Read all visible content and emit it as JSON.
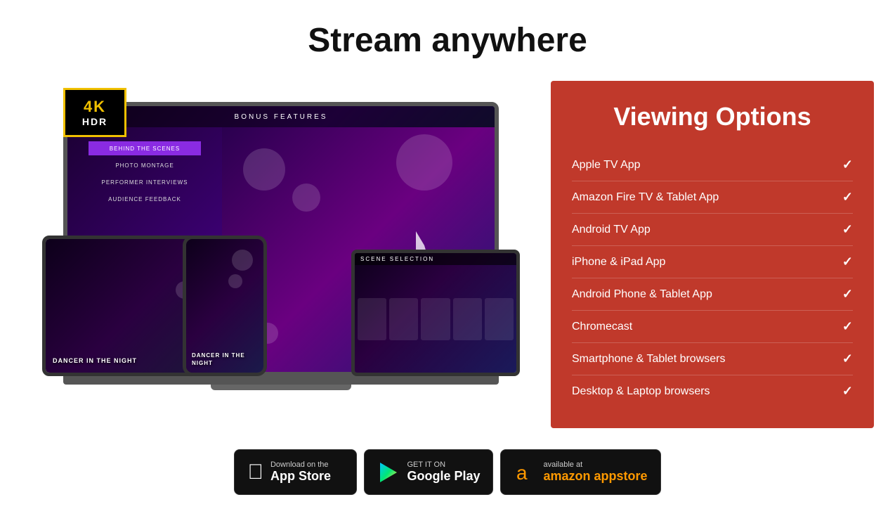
{
  "page": {
    "title": "Stream anywhere"
  },
  "badge4k": {
    "line1": "4K",
    "line2": "HDR"
  },
  "laptopScreen": {
    "nav": "BONUS FEATURES",
    "menuItems": [
      {
        "label": "BEHIND THE SCENES",
        "active": true
      },
      {
        "label": "PHOTO MONTAGE",
        "active": false
      },
      {
        "label": "PERFORMER INTERVIEWS",
        "active": false
      },
      {
        "label": "AUDIENCE FEEDBACK",
        "active": false
      }
    ]
  },
  "tabletTitle": "DANCER IN\nTHE NIGHT",
  "phoneTitle": "DANCER IN\nTHE NIGHT",
  "iPadHeader": "SCENE SELECTION",
  "viewingOptions": {
    "title": "Viewing Options",
    "items": [
      {
        "label": "Apple TV App",
        "checked": true
      },
      {
        "label": "Amazon Fire TV & Tablet App",
        "checked": true
      },
      {
        "label": "Android TV App",
        "checked": true
      },
      {
        "label": "iPhone & iPad App",
        "checked": true
      },
      {
        "label": "Android Phone & Tablet App",
        "checked": true
      },
      {
        "label": "Chromecast",
        "checked": true
      },
      {
        "label": "Smartphone & Tablet browsers",
        "checked": true
      },
      {
        "label": "Desktop & Laptop browsers",
        "checked": true
      }
    ]
  },
  "storeBadges": {
    "appStore": {
      "smallText": "Download on the",
      "bigText": "App Store"
    },
    "googlePlay": {
      "smallText": "GET IT ON",
      "bigText": "Google Play"
    },
    "amazonAppstore": {
      "smallText": "available at",
      "bigText": "amazon appstore"
    }
  }
}
